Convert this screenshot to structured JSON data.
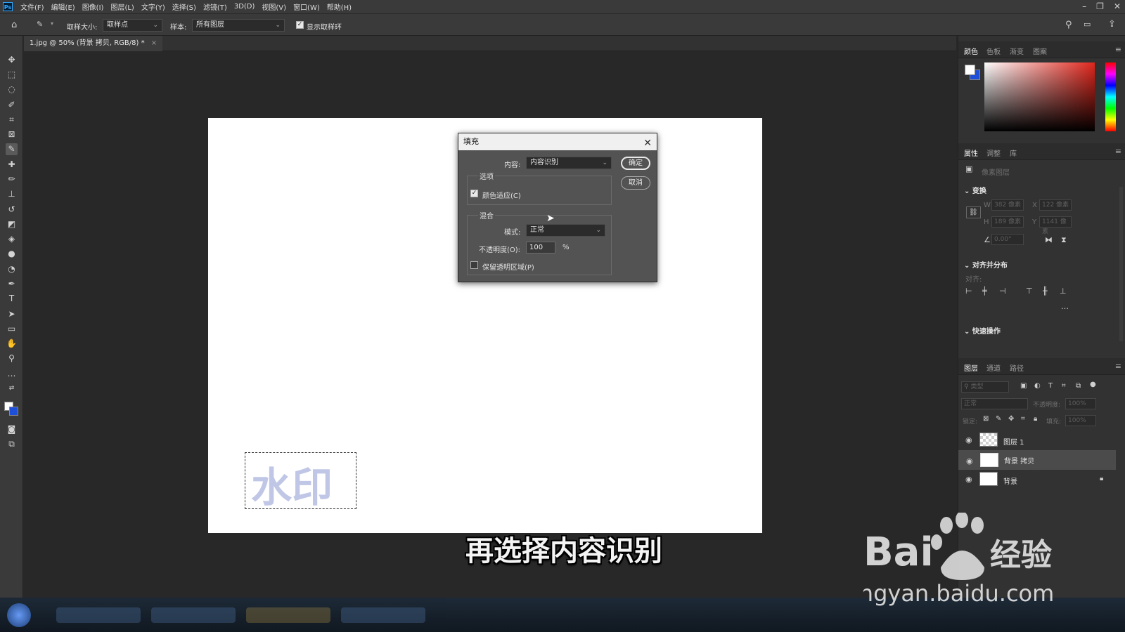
{
  "menubar": {
    "app_icon": "Ps",
    "items": [
      "文件(F)",
      "编辑(E)",
      "图像(I)",
      "图层(L)",
      "文字(Y)",
      "选择(S)",
      "滤镜(T)",
      "3D(D)",
      "视图(V)",
      "窗口(W)",
      "帮助(H)"
    ]
  },
  "optbar": {
    "sample_size_label": "取样大小:",
    "sample_size_value": "取样点",
    "sample_label": "样本:",
    "sample_value": "所有图层",
    "show_ring_label": "显示取样环"
  },
  "document": {
    "tab_title": "1.jpg @ 50% (背景 拷贝, RGB/8) *",
    "watermark_text": "水印"
  },
  "dialog": {
    "title": "填充",
    "content_label": "内容:",
    "content_value": "内容识别",
    "options_group": "选项",
    "color_adapt_label": "颜色适应(C)",
    "color_adapt_checked": true,
    "blend_group": "混合",
    "mode_label": "模式:",
    "mode_value": "正常",
    "opacity_label": "不透明度(O):",
    "opacity_value": "100",
    "opacity_unit": "%",
    "preserve_label": "保留透明区域(P)",
    "preserve_checked": false,
    "ok_label": "确定",
    "cancel_label": "取消"
  },
  "color_panel": {
    "tabs": [
      "颜色",
      "色板",
      "渐变",
      "图案"
    ],
    "hue_color": "#e0261c"
  },
  "properties_panel": {
    "tabs": [
      "属性",
      "调整",
      "库"
    ],
    "layer_type": "像素图层",
    "transform_title": "变换",
    "w_label": "W",
    "w_value": "382 像素",
    "x_label": "X",
    "x_value": "122 像素",
    "h_label": "H",
    "h_value": "189 像素",
    "y_label": "Y",
    "y_value": "1141 像素",
    "angle_value": "0.00°",
    "align_title": "对齐并分布",
    "align_sub": "对齐:",
    "quick_title": "快速操作"
  },
  "layers_panel": {
    "tabs": [
      "图层",
      "通道",
      "路径"
    ],
    "filter_placeholder": "类型",
    "blend_mode": "正常",
    "opacity_label": "不透明度:",
    "opacity_value": "100%",
    "lock_label": "锁定:",
    "fill_label": "填充:",
    "fill_value": "100%",
    "layers": [
      {
        "name": "图层 1",
        "thumb": "transparent",
        "selected": false,
        "locked": false
      },
      {
        "name": "背景 拷贝",
        "thumb": "white",
        "selected": true,
        "locked": false
      },
      {
        "name": "背景",
        "thumb": "white",
        "selected": false,
        "locked": true
      }
    ]
  },
  "subtitle": "再选择内容识别",
  "baidu_watermark": {
    "brand": "Bai",
    "brand_suffix": "经验",
    "url": "jingyan.baidu.com"
  }
}
